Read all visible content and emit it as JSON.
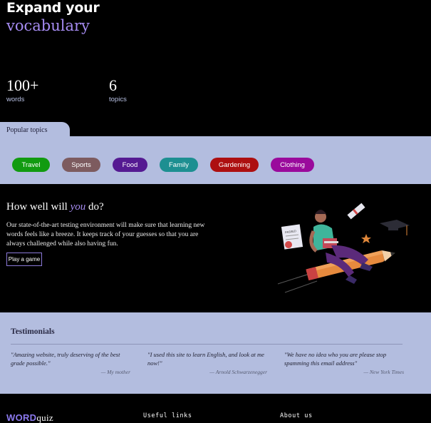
{
  "hero": {
    "title_line1": "Expand your",
    "title_line2": "vocabulary",
    "stats": [
      {
        "value": "100+",
        "label": "words"
      },
      {
        "value": "6",
        "label": "topics"
      }
    ]
  },
  "topics": {
    "tab_label": "Popular topics",
    "chips": [
      {
        "label": "Travel",
        "color": "#119b10"
      },
      {
        "label": "Sports",
        "color": "#7d5b5f"
      },
      {
        "label": "Food",
        "color": "#551a92"
      },
      {
        "label": "Family",
        "color": "#1d8f91"
      },
      {
        "label": "Gardening",
        "color": "#ad0f10"
      },
      {
        "label": "Clothing",
        "color": "#9a0a9c"
      }
    ]
  },
  "game": {
    "title_pre": "How well will ",
    "title_hl": "you",
    "title_post": " do?",
    "body": "Our state-of-the-art testing environment will make sure that learning new words feels like a breeze. It keeps track of your guesses so that you are always challenged while also having fun.",
    "button_label": "Play a game",
    "certificate_text": "PASSED"
  },
  "testimonials": {
    "title": "Testimonials",
    "items": [
      {
        "quote": "\"Amazing website, truly deserving of the best grade possible.\"",
        "author": "— My mother"
      },
      {
        "quote": "\"I used this site to learn English, and look at me now!\"",
        "author": "— Arnold Schwarzenegger"
      },
      {
        "quote": "\"We have no idea who you are please stop spamming this email address\"",
        "author": "— New York Times"
      }
    ]
  },
  "footer": {
    "logo_bold": "WORD",
    "logo_rest": "quiz",
    "useful_links": "Useful links",
    "about_us": "About us"
  },
  "colors": {
    "accent": "#a68cf2",
    "band": "#b3bddf",
    "background": "#000000"
  }
}
